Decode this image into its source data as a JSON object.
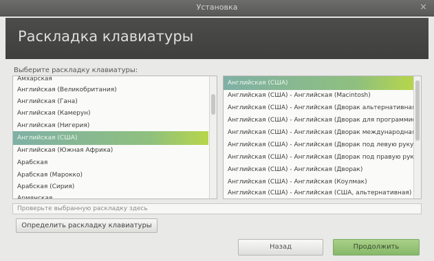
{
  "window": {
    "title": "Установка",
    "close_symbol": "×"
  },
  "header": {
    "title": "Раскладка клавиатуры"
  },
  "layout_prompt": "Выберите раскладку клавиатуры:",
  "layouts": {
    "items": [
      "Амхарская",
      "Английская (Великобритания)",
      "Английская (Гана)",
      "Английская (Камерун)",
      "Английская (Нигерия)",
      "Английская (США)",
      "Английская (Южная Африка)",
      "Арабская",
      "Арабская (Марокко)",
      "Арабская (Сирия)",
      "Армянская"
    ],
    "selected": "Английская (США)"
  },
  "variants": {
    "items": [
      "Английская (США)",
      "Английская (США) - Английская (Macintosh)",
      "Английская (США) - Английская (Дворак альтернативная)",
      "Английская (США) - Английская (Дворак для программистов)",
      "Английская (США) - Английская (Дворак международная)",
      "Английская (США) - Английская (Дворак под левую руку)",
      "Английская (США) - Английская (Дворак под правую руку)",
      "Английская (США) - Английская (Дворак)",
      "Английская (США) - Английская (Коулмак)",
      "Английская (США) - Английская (США, альтернативная)"
    ],
    "selected": "Английская (США)"
  },
  "test_field": {
    "placeholder": "Проверьте выбранную раскладку здесь",
    "value": ""
  },
  "buttons": {
    "detect": "Определить раскладку клавиатуры",
    "back": "Назад",
    "continue": "Продолжить"
  },
  "colors": {
    "selection_start": "#7fb0a6",
    "selection_end": "#b7d64a",
    "header_bg": "#464644",
    "continue_bg": "#98c479"
  }
}
